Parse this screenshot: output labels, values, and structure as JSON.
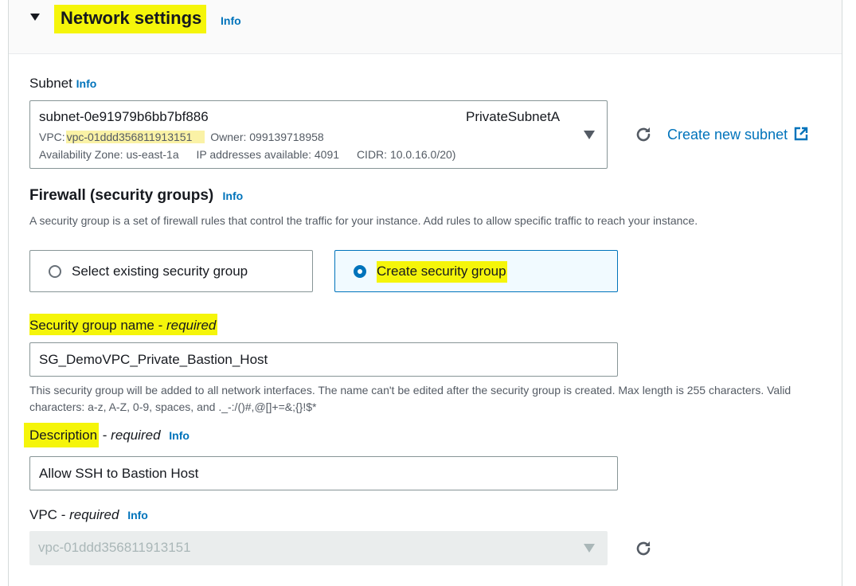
{
  "section": {
    "title": "Network settings",
    "info": "Info"
  },
  "subnet": {
    "label": "Subnet",
    "info": "Info",
    "selected": {
      "id": "subnet-0e91979b6bb7bf886",
      "name": "PrivateSubnetA",
      "vpc_prefix": "VPC:",
      "vpc_id": "vpc-01ddd356811913151",
      "owner": "Owner: 099139718958",
      "az": "Availability Zone: us-east-1a",
      "ips": "IP addresses available: 4091",
      "cidr": "CIDR: 10.0.16.0/20)"
    },
    "create_link": "Create new subnet"
  },
  "firewall": {
    "title": "Firewall (security groups)",
    "info": "Info",
    "description": "A security group is a set of firewall rules that control the traffic for your instance. Add rules to allow specific traffic to reach your instance.",
    "options": {
      "existing": "Select existing security group",
      "create": "Create security group"
    },
    "selected": "create"
  },
  "sg_name": {
    "label": "Security group name",
    "required": "required",
    "value": "SG_DemoVPC_Private_Bastion_Host",
    "hint": "This security group will be added to all network interfaces. The name can't be edited after the security group is created. Max length is 255 characters. Valid characters: a-z, A-Z, 0-9, spaces, and ._-:/()#,@[]+=&;{}!$*"
  },
  "description": {
    "label": "Description",
    "required": "required",
    "info": "Info",
    "value": "Allow SSH to Bastion Host"
  },
  "vpc": {
    "label": "VPC",
    "required": "required",
    "info": "Info",
    "value": "vpc-01ddd356811913151"
  },
  "colors": {
    "accent": "#0073bb",
    "highlight": "#f5f50a",
    "selected_tile_bg": "#f1faff"
  }
}
